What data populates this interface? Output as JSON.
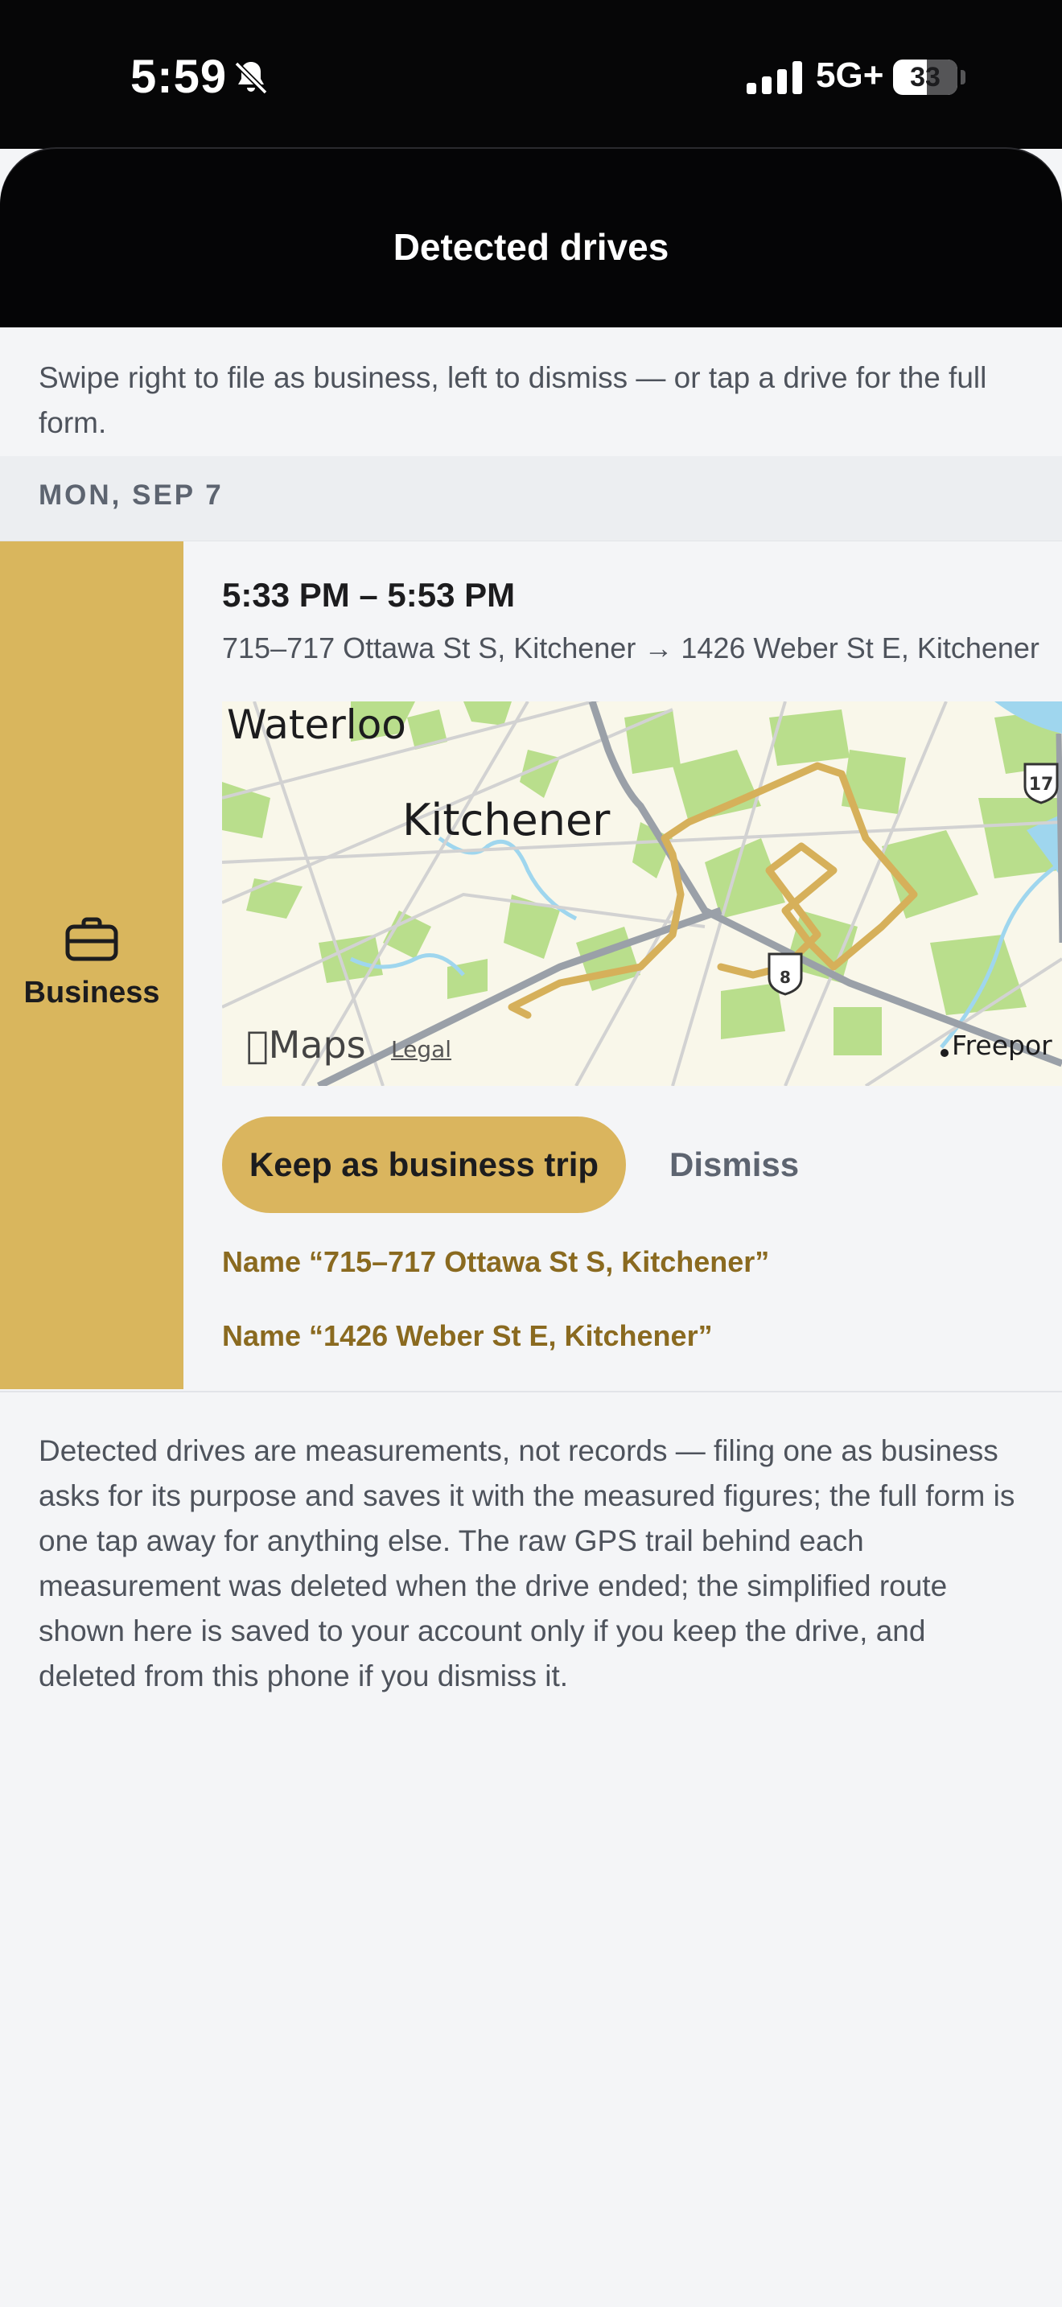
{
  "status_bar": {
    "time": "5:59",
    "network": "5G+",
    "battery": "33"
  },
  "nav": {
    "title": "Detected drives"
  },
  "intro": "Swipe right to file as business, left to dismiss — or tap a drive for the full form.",
  "section": {
    "date": "MON, SEP 7"
  },
  "drive": {
    "category": "Business",
    "time_range": "5:33 PM – 5:53 PM",
    "route": "715–717 Ottawa St S, Kitchener → 1426 Weber St E, Kitchener",
    "map": {
      "labels": {
        "city1": "Waterloo",
        "city2": "Kitchener",
        "place": "Freepor"
      },
      "shields": [
        "17",
        "8"
      ],
      "attribution": "Maps",
      "legal": "Legal",
      "route_color": "#d6b05a"
    },
    "actions": {
      "keep": "Keep as business trip",
      "dismiss": "Dismiss",
      "name_origin": "Name “715–717 Ottawa St S, Kitchener”",
      "name_destination": "Name “1426 Weber St E, Kitchener”"
    }
  },
  "footer": "Detected drives are measurements, not records — filing one as business asks for its purpose and saves it with the measured figures; the full form is one tap away for anything else. The raw GPS trail behind each measurement was deleted when the drive ended; the simplified route shown here is saved to your account only if you keep the drive, and deleted from this phone if you dismiss it.",
  "colors": {
    "accent": "#d9b65d",
    "link": "#8a6a20",
    "nav_bg": "#050506"
  }
}
